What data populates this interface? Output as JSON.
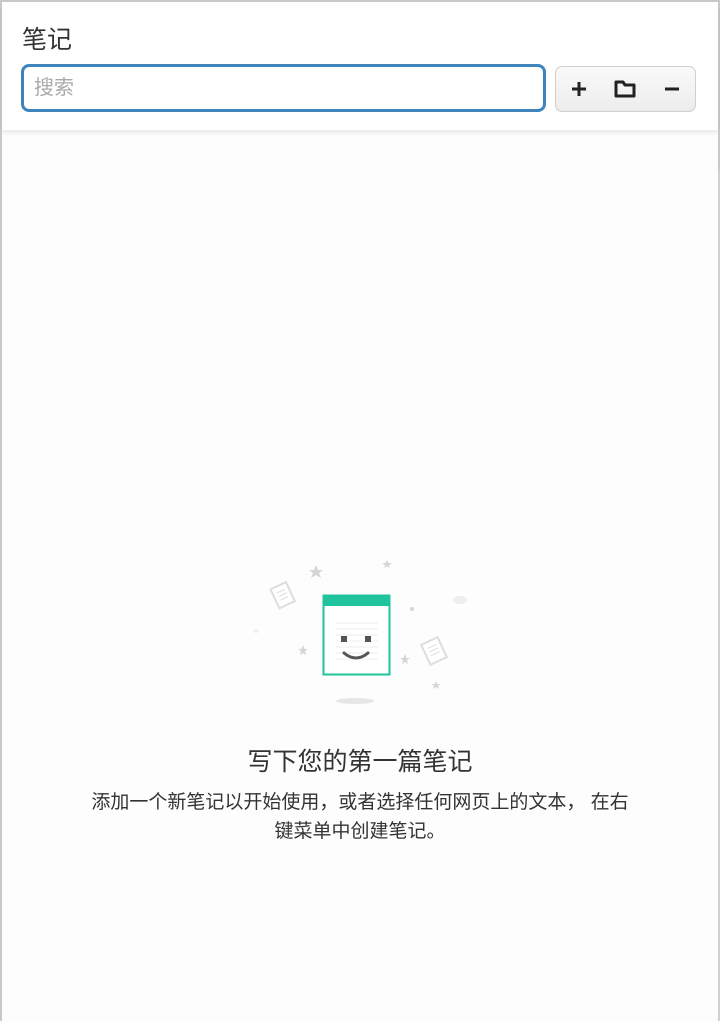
{
  "header": {
    "title": "笔记",
    "search_placeholder": "搜索"
  },
  "toolbar": {
    "add_icon": "plus-icon",
    "folder_icon": "folder-icon",
    "remove_icon": "minus-icon"
  },
  "empty_state": {
    "heading": "写下您的第一篇笔记",
    "description_line1": "添加一个新笔记以开始使用，或者选择任何网页上的文本， 在右",
    "description_line2": "键菜单中创建笔记。"
  },
  "colors": {
    "accent": "#3f84bd",
    "illustration": "#1fc49c"
  }
}
